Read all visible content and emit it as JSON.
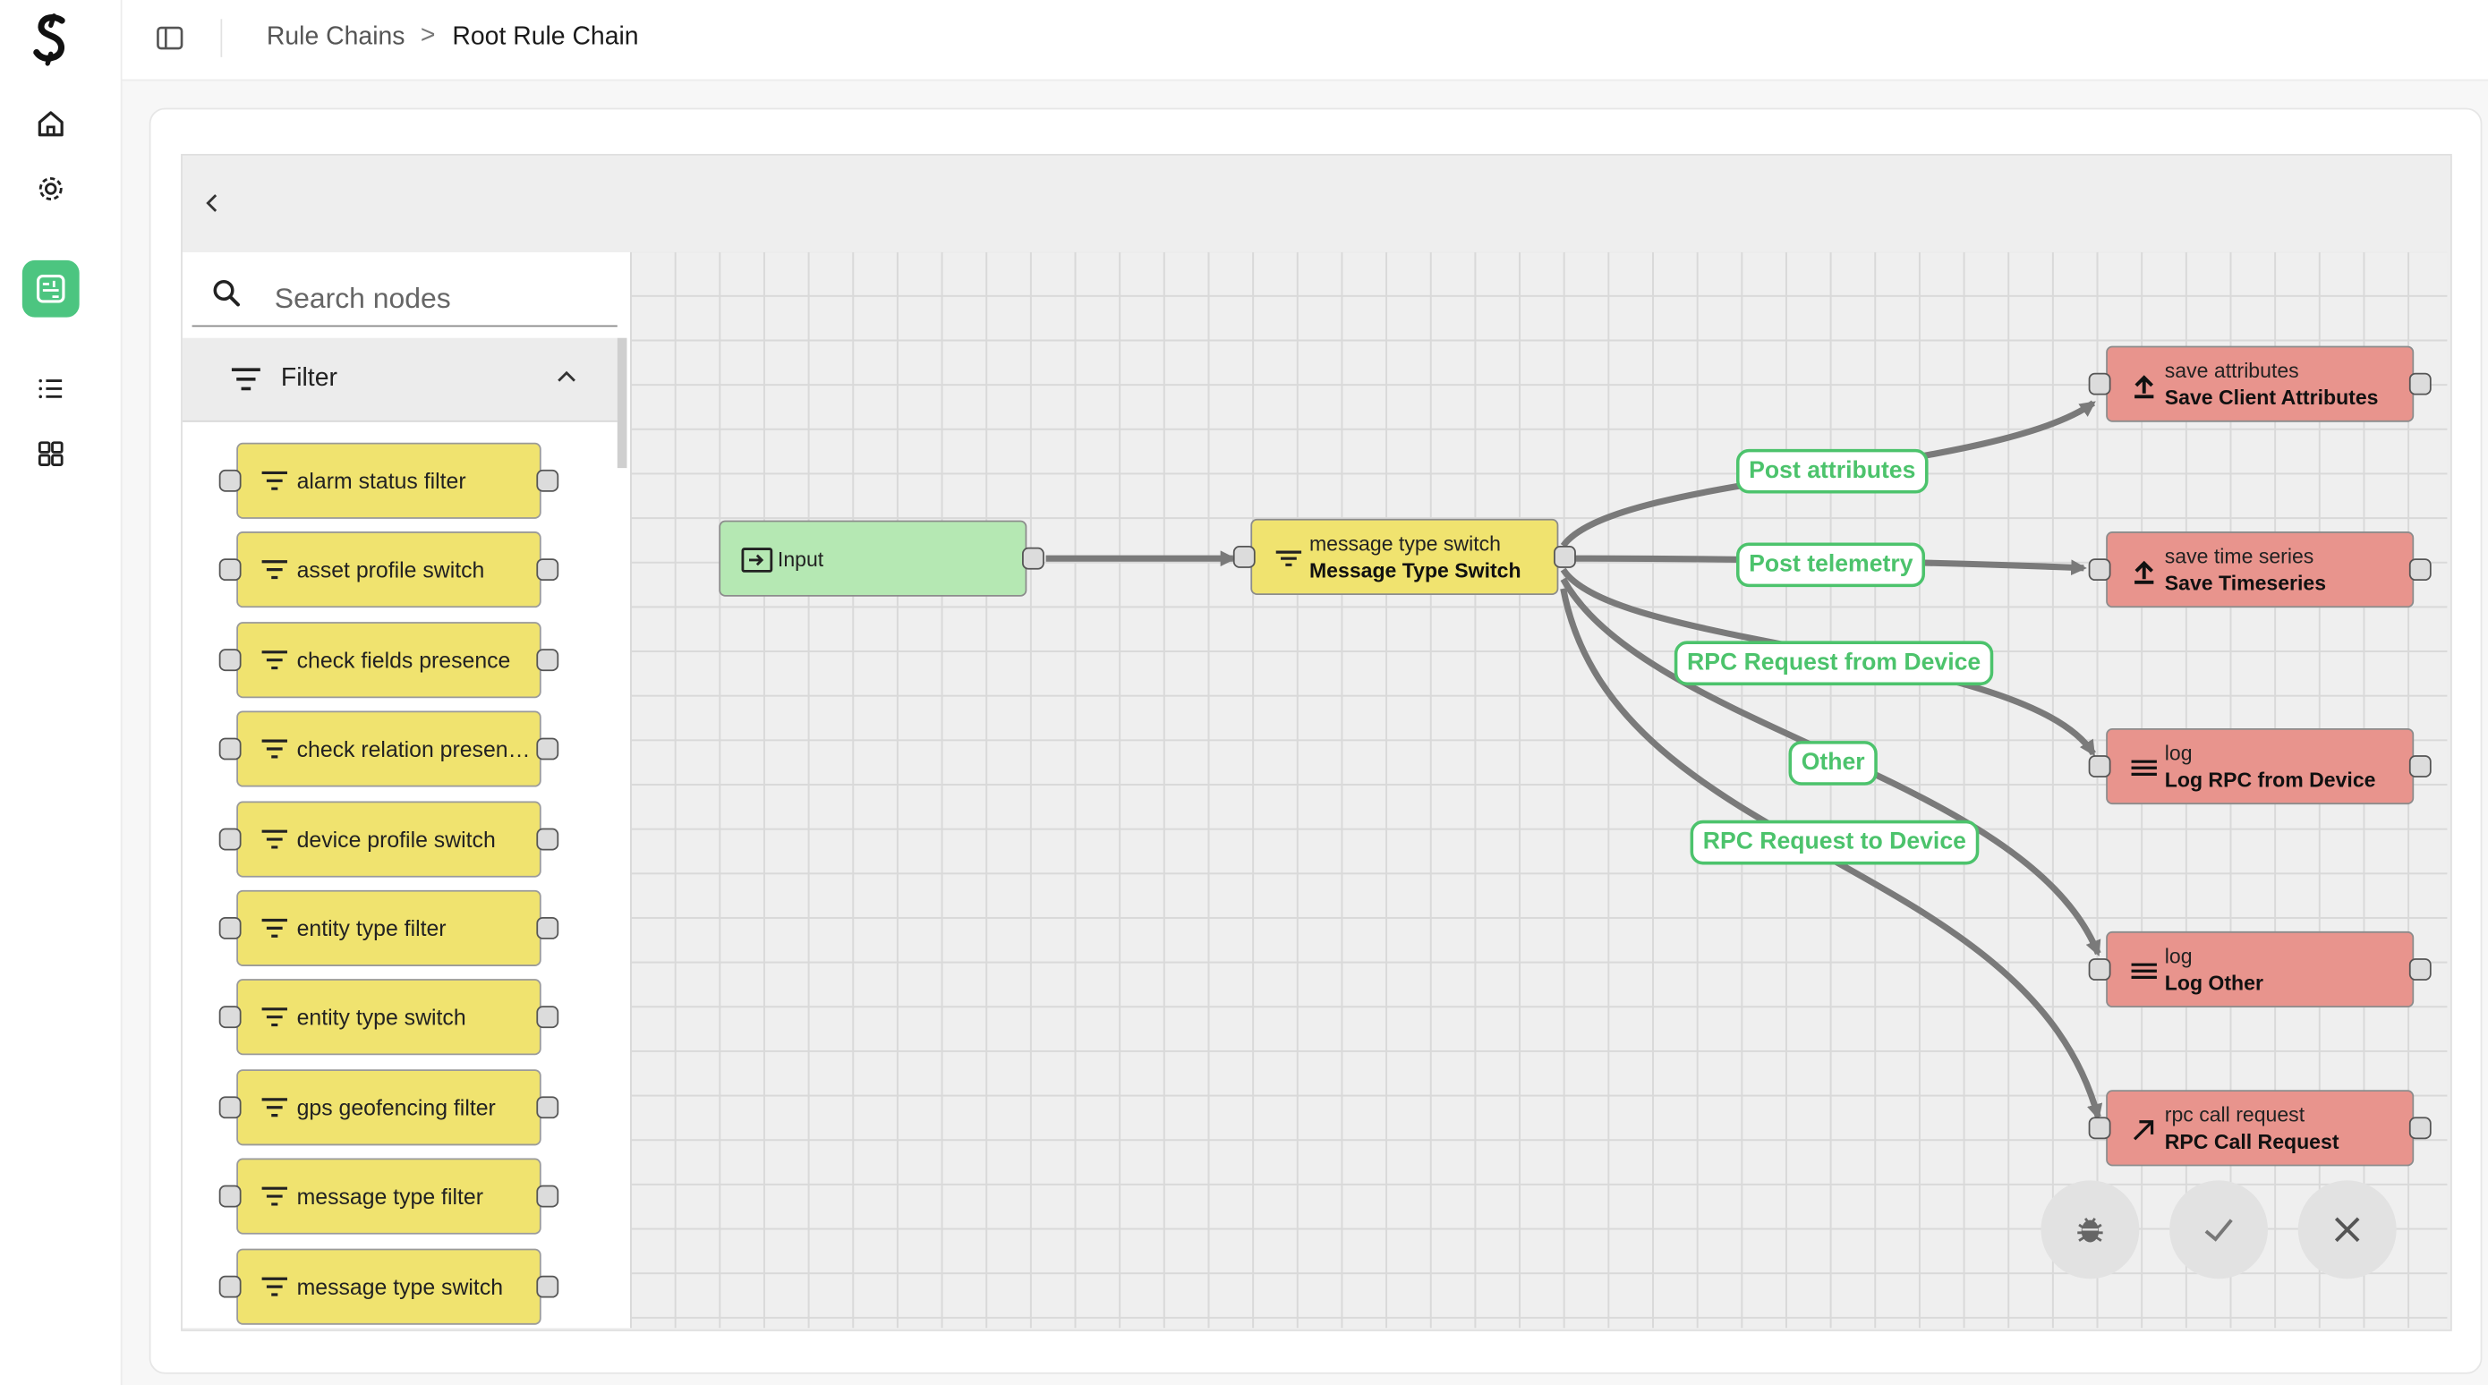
{
  "header": {
    "breadcrumb_parent": "Rule Chains",
    "breadcrumb_separator": ">",
    "breadcrumb_current": "Root Rule Chain"
  },
  "sidebar": {
    "items": [
      {
        "icon": "home-icon"
      },
      {
        "icon": "gear-icon"
      },
      {
        "icon": "rule-chain-icon",
        "active": true
      },
      {
        "icon": "list-icon"
      },
      {
        "icon": "dashboard-icon"
      }
    ]
  },
  "library": {
    "search_placeholder": "Search nodes",
    "section_title": "Filter",
    "nodes": [
      "alarm status filter",
      "asset profile switch",
      "check fields presence",
      "check relation presen…",
      "device profile switch",
      "entity type filter",
      "entity type switch",
      "gps geofencing filter",
      "message type filter",
      "message type switch"
    ]
  },
  "canvas": {
    "input_node": {
      "label": "Input"
    },
    "switch_node": {
      "type": "message type switch",
      "name": "Message Type Switch"
    },
    "action_nodes": [
      {
        "type": "save attributes",
        "name": "Save Client Attributes",
        "icon": "upload-icon"
      },
      {
        "type": "save time series",
        "name": "Save Timeseries",
        "icon": "upload-icon"
      },
      {
        "type": "log",
        "name": "Log RPC from Device",
        "icon": "menu-icon"
      },
      {
        "type": "log",
        "name": "Log Other",
        "icon": "menu-icon"
      },
      {
        "type": "rpc call request",
        "name": "RPC Call Request",
        "icon": "arrow-up-right-icon"
      }
    ],
    "edge_labels": [
      "Post attributes",
      "Post telemetry",
      "RPC Request from Device",
      "Other",
      "RPC Request to Device"
    ]
  },
  "colors": {
    "accent": "#4cc580",
    "filter_node": "#f0e36f",
    "input_node": "#b5e8b3",
    "action_node": "#e8948d",
    "edge": "#7a7a7a",
    "edge_label": "#4cc36c"
  }
}
